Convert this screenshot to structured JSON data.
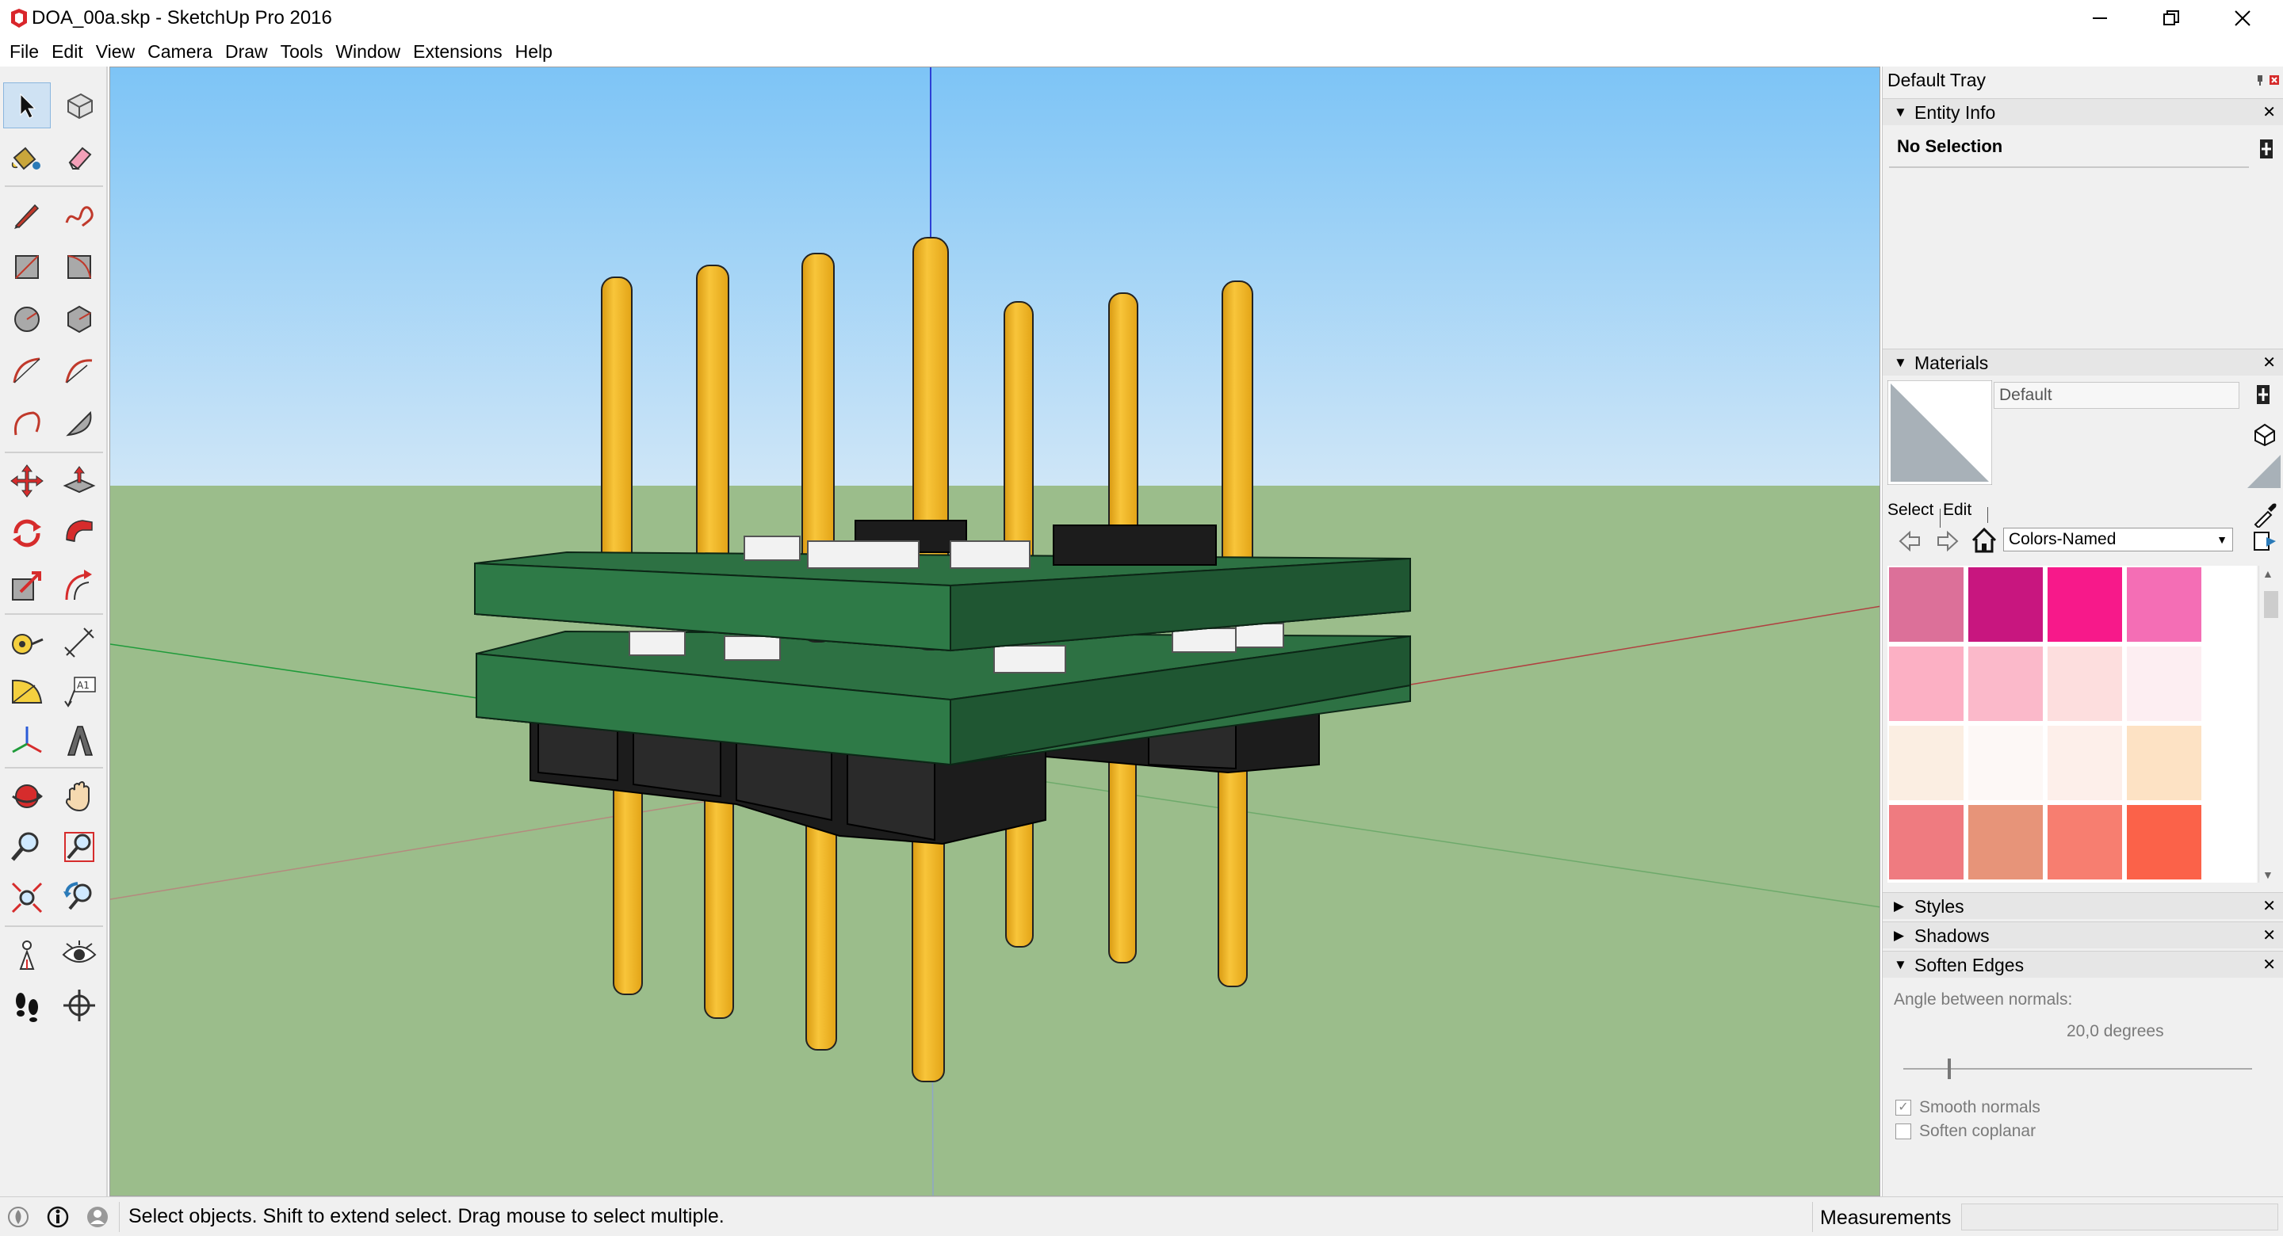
{
  "window": {
    "title": "DOA_00a.skp - SketchUp Pro 2016"
  },
  "menu": [
    "File",
    "Edit",
    "View",
    "Camera",
    "Draw",
    "Tools",
    "Window",
    "Extensions",
    "Help"
  ],
  "tray": {
    "title": "Default Tray",
    "entity_info": {
      "header": "Entity Info",
      "selection": "No Selection"
    },
    "materials": {
      "header": "Materials",
      "name_value": "Default",
      "tab_select": "Select",
      "tab_edit": "Edit",
      "library": "Colors-Named",
      "swatch_colors": [
        "#dc7099",
        "#c8167f",
        "#f7198a",
        "#f46eb5",
        "#fcb0c4",
        "#fbb9ca",
        "#fddede",
        "#fdeef2",
        "#fbeee2",
        "#fdf8f6",
        "#fdefea",
        "#fde2c4",
        "#ef7b80",
        "#e79479",
        "#f77e70",
        "#fb6249"
      ]
    },
    "styles": {
      "header": "Styles"
    },
    "shadows": {
      "header": "Shadows"
    },
    "soften_edges": {
      "header": "Soften Edges",
      "angle_label": "Angle between normals:",
      "angle_value": "20,0  degrees",
      "smooth_normals": "Smooth normals",
      "soften_coplanar": "Soften coplanar"
    }
  },
  "status": {
    "message": "Select objects. Shift to extend select. Drag mouse to select multiple.",
    "measurements_label": "Measurements"
  },
  "colors": {
    "sky_top": "#7ec4f4",
    "sky_bottom": "#cde6f7",
    "ground": "#9bbd8b",
    "board": "#2d7143",
    "pin": "#f2b21b",
    "connector": "#1c1c1c"
  },
  "tools": [
    "select-icon",
    "component-icon",
    "paint-bucket-icon",
    "eraser-icon",
    "line-icon",
    "freehand-icon",
    "rectangle-icon",
    "rotated-rectangle-icon",
    "circle-icon",
    "polygon-icon",
    "arc-icon",
    "two-point-arc-icon",
    "three-point-arc-icon",
    "pie-icon",
    "move-icon",
    "push-pull-icon",
    "rotate-icon",
    "follow-me-icon",
    "scale-icon",
    "offset-icon",
    "tape-measure-icon",
    "dimension-icon",
    "protractor-icon",
    "text-icon",
    "axes-icon",
    "3d-text-icon",
    "orbit-icon",
    "pan-icon",
    "zoom-icon",
    "zoom-window-icon",
    "zoom-extents-icon",
    "previous-view-icon",
    "position-camera-icon",
    "look-around-icon",
    "walk-icon",
    "section-plane-icon"
  ]
}
